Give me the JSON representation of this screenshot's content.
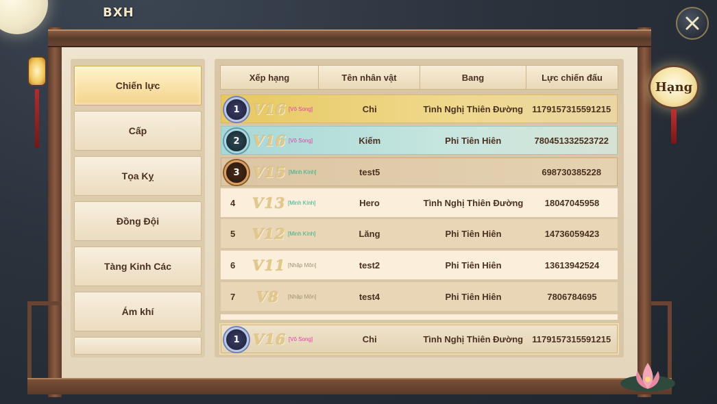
{
  "window": {
    "title": "BXH"
  },
  "rank_button": {
    "label": "Hạng"
  },
  "sidebar": {
    "items": [
      {
        "label": "Chiến lực",
        "active": true
      },
      {
        "label": "Cấp",
        "active": false
      },
      {
        "label": "Tọa Kỵ",
        "active": false
      },
      {
        "label": "Đồng Đội",
        "active": false
      },
      {
        "label": "Tàng Kinh Các",
        "active": false
      },
      {
        "label": "Ám khí",
        "active": false
      }
    ]
  },
  "table": {
    "columns": [
      "Xếp hạng",
      "Tên nhân vật",
      "Bang",
      "Lực chiến đấu"
    ],
    "rows": [
      {
        "rank": "1",
        "vip": "V16",
        "tier": "[Vô Song]",
        "name": "Chi",
        "guild": "Tình Nghị Thiên Đường",
        "power": "1179157315591215"
      },
      {
        "rank": "2",
        "vip": "V16",
        "tier": "[Vô Song]",
        "name": "Kiếm",
        "guild": "Phi Tiên Hiên",
        "power": "780451332523722"
      },
      {
        "rank": "3",
        "vip": "V15",
        "tier": "[Minh Kính]",
        "name": "test5",
        "guild": "",
        "power": "698730385228"
      },
      {
        "rank": "4",
        "vip": "V13",
        "tier": "[Minh Kính]",
        "name": "Hero",
        "guild": "Tình Nghị Thiên Đường",
        "power": "18047045958"
      },
      {
        "rank": "5",
        "vip": "V12",
        "tier": "[Minh Kính]",
        "name": "Lăng",
        "guild": "Phi Tiên Hiên",
        "power": "14736059423"
      },
      {
        "rank": "6",
        "vip": "V11",
        "tier": "[Nhập Môn]",
        "name": "test2",
        "guild": "Phi Tiên Hiên",
        "power": "13613942524"
      },
      {
        "rank": "7",
        "vip": "V8",
        "tier": "[Nhập Môn]",
        "name": "test4",
        "guild": "Phi Tiên Hiên",
        "power": "7806784695"
      }
    ],
    "my_row": {
      "rank": "1",
      "vip": "V16",
      "tier": "[Vô Song]",
      "name": "Chi",
      "guild": "Tình Nghị Thiên Đường",
      "power": "1179157315591215"
    }
  },
  "colors": {
    "rank1_row": "#e7c860",
    "rank2_row": "#a7d8d6",
    "rank3_row": "#dcc6a4",
    "tier_vo_song": "#e03ca8",
    "tier_minh_kinh": "#2fb08a",
    "tier_nhap_mon": "#a09070"
  },
  "icons": {
    "close": "close-icon",
    "medal": "rank-medal-icon"
  }
}
